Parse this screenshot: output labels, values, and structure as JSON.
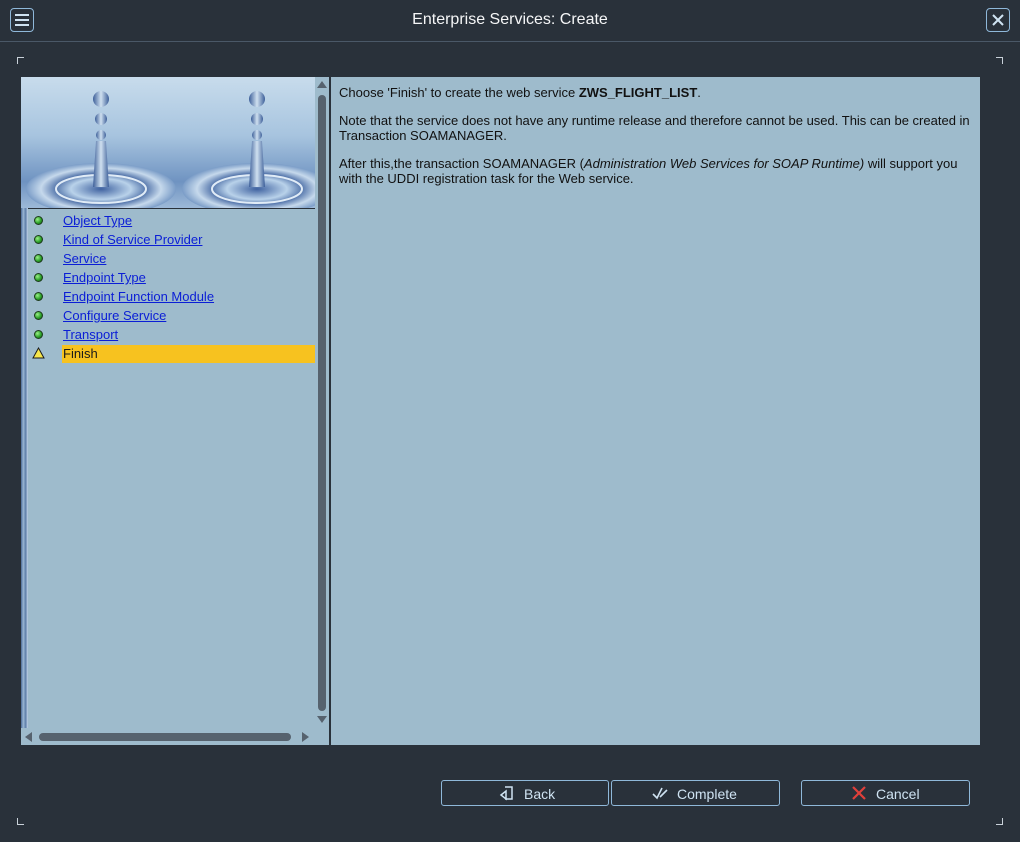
{
  "window": {
    "title": "Enterprise Services: Create",
    "menu_icon": "hamburger-menu-icon",
    "close_icon": "close-icon"
  },
  "steps": [
    {
      "label": "Object Type",
      "status": "done"
    },
    {
      "label": "Kind of Service Provider",
      "status": "done"
    },
    {
      "label": "Service",
      "status": "done"
    },
    {
      "label": "Endpoint Type",
      "status": "done"
    },
    {
      "label": "Endpoint Function Module",
      "status": "done"
    },
    {
      "label": "Configure Service",
      "status": "done"
    },
    {
      "label": "Transport",
      "status": "done"
    },
    {
      "label": "Finish",
      "status": "current"
    }
  ],
  "content": {
    "p1_before": "Choose 'Finish' to create the web service ",
    "p1_bold": "ZWS_FLIGHT_LIST",
    "p1_after": ".",
    "p2": "Note that the service does not have any runtime release and therefore cannot be used. This can be created in Transaction SOAMANAGER.",
    "p3_before": "After this,the transaction SOAMANAGER (",
    "p3_italic": "Administration Web Services for SOAP Runtime)",
    "p3_after": " will support you with the UDDI registration task for the Web service."
  },
  "buttons": {
    "back": "Back",
    "complete": "Complete",
    "cancel": "Cancel"
  },
  "colors": {
    "frame": "#29313a",
    "panel": "#9ebbcc",
    "link": "#0b1ed6",
    "highlight": "#f7c21f",
    "cancel_icon": "#e0403a"
  }
}
